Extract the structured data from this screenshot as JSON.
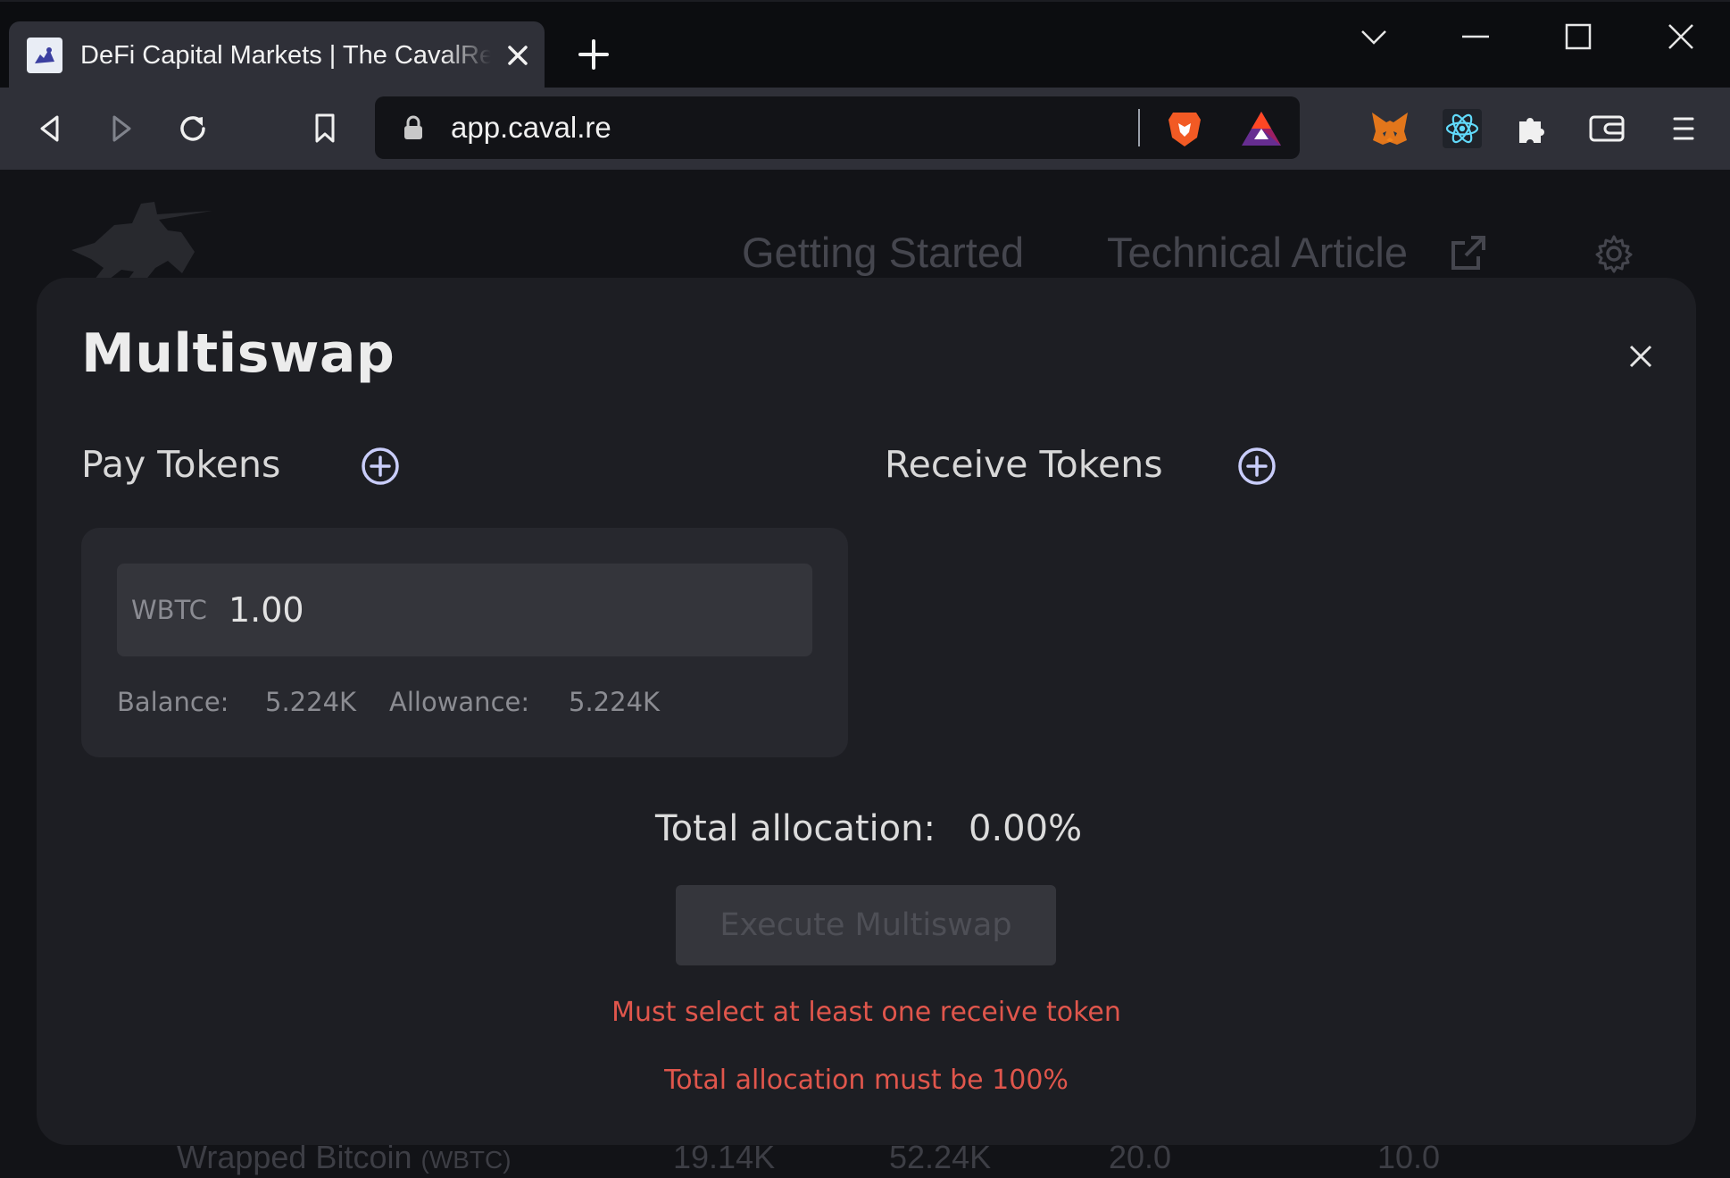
{
  "browser": {
    "tab_title": "DeFi Capital Markets | The CavalRe",
    "url": "app.caval.re"
  },
  "background": {
    "nav": {
      "getting_started": "Getting Started",
      "technical_article": "Technical Article"
    },
    "row": {
      "name": "Wrapped Bitcoin",
      "symbol": "(WBTC)",
      "col1": "19.14K",
      "col2": "52.24K",
      "col3": "20.0",
      "col4": "10.0"
    }
  },
  "modal": {
    "title": "Multiswap",
    "pay_section": {
      "title": "Pay Tokens",
      "token": {
        "symbol": "WBTC",
        "amount": "1.00",
        "balance_label": "Balance:",
        "balance_value": "5.224K",
        "allowance_label": "Allowance:",
        "allowance_value": "5.224K"
      }
    },
    "receive_section": {
      "title": "Receive Tokens"
    },
    "allocation": {
      "label": "Total allocation:",
      "value": "0.00%"
    },
    "execute_label": "Execute Multiswap",
    "errors": [
      "Must select at least one receive token",
      "Total allocation must be 100%"
    ]
  },
  "colors": {
    "modal_bg": "#1d1e23",
    "card_bg": "#27282e",
    "error": "#e0564c",
    "accent_icon": "#c9cdfa"
  }
}
